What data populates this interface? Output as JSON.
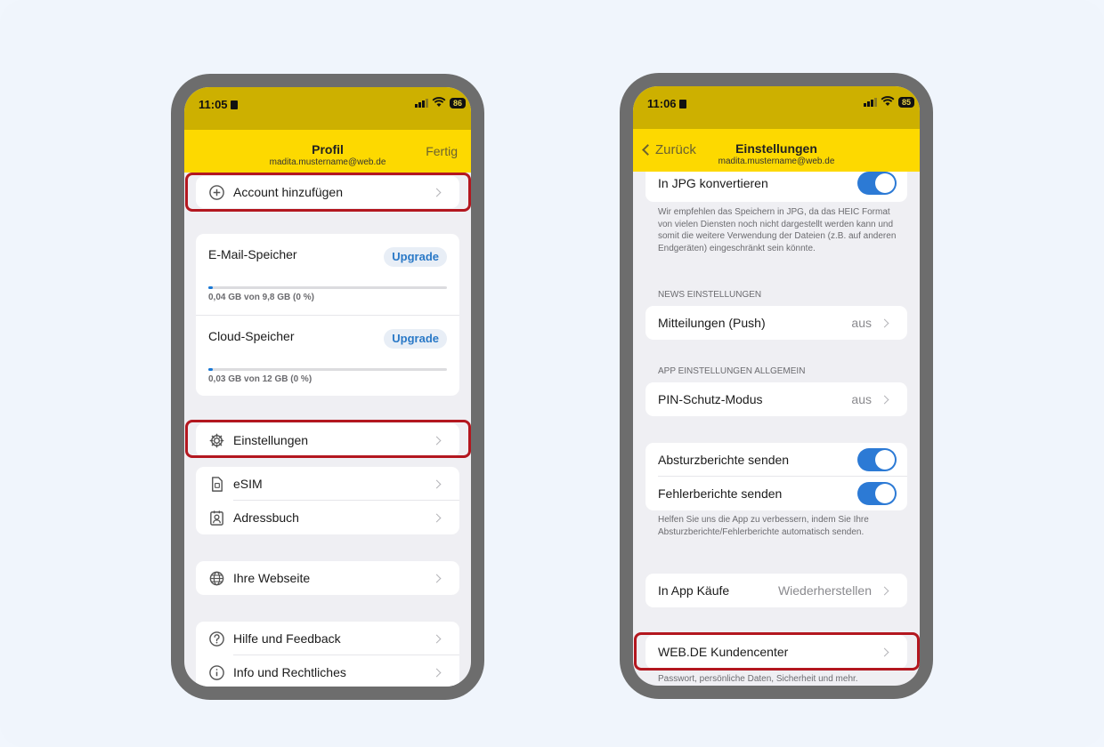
{
  "left_phone": {
    "status": {
      "time": "11:05",
      "battery": "86"
    },
    "nav": {
      "title": "Profil",
      "subtitle": "madita.mustername@web.de",
      "done": "Fertig"
    },
    "add_account": "Account hinzufügen",
    "storage": {
      "upgrade_label": "Upgrade",
      "items": [
        {
          "title": "E-Mail-Speicher",
          "note": "0,04 GB von 9,8 GB (0 %)",
          "fill_percent": 2
        },
        {
          "title": "Cloud-Speicher",
          "note": "0,03 GB von 12 GB (0 %)",
          "fill_percent": 2
        }
      ]
    },
    "settings": "Einstellungen",
    "esim": "eSIM",
    "address_book": "Adressbuch",
    "website": "Ihre Webseite",
    "help": "Hilfe und Feedback",
    "info": "Info und Rechtliches"
  },
  "right_phone": {
    "status": {
      "time": "11:06",
      "battery": "85"
    },
    "nav": {
      "back": "Zurück",
      "title": "Einstellungen",
      "subtitle": "madita.mustername@web.de"
    },
    "jpg_row": "In JPG konvertieren",
    "jpg_note": "Wir empfehlen das Speichern in JPG, da das HEIC Format von vielen Diensten noch nicht dargestellt werden kann und somit die weitere Verwendung der Dateien (z.B. auf anderen Endgeräten) eingeschränkt sein könnte.",
    "news_header": "NEWS EINSTELLUNGEN",
    "push_label": "Mitteilungen (Push)",
    "push_value": "aus",
    "app_header": "APP EINSTELLUNGEN ALLGEMEIN",
    "pin_label": "PIN-Schutz-Modus",
    "pin_value": "aus",
    "crash_label": "Absturzberichte senden",
    "error_label": "Fehlerberichte senden",
    "reports_note": "Helfen Sie uns die App zu verbessern, indem Sie Ihre Absturzberichte/Fehlerberichte automatisch senden.",
    "iap_label": "In App Käufe",
    "iap_value": "Wiederherstellen",
    "kundencenter_label": "WEB.DE Kundencenter",
    "kundencenter_note": "Passwort, persönliche Daten, Sicherheit und mehr."
  },
  "colors": {
    "status_bar": "#cdb000",
    "nav_bar": "#fdd900",
    "highlight": "#b3171f",
    "toggle_on": "#2c7ad5",
    "upgrade_text": "#2a79c7"
  }
}
